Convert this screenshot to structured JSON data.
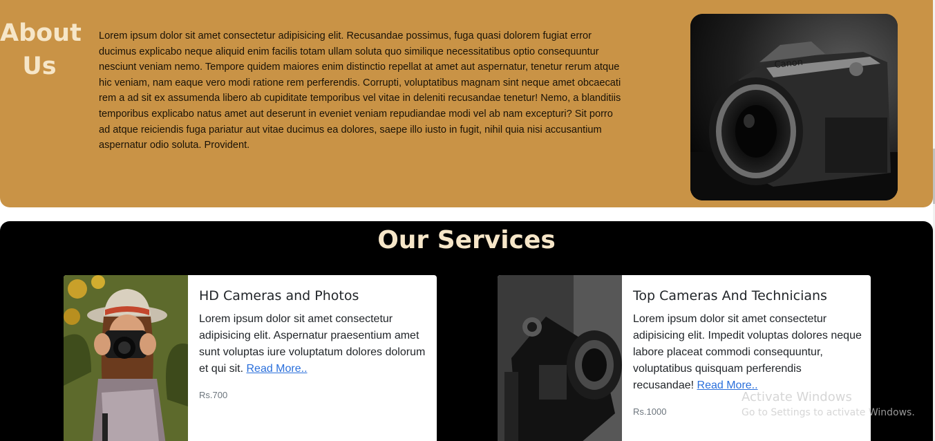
{
  "about": {
    "title_line1": "About",
    "title_line2": "Us",
    "paragraph": "Lorem ipsum dolor sit amet consectetur adipisicing elit. Recusandae possimus, fuga quasi dolorem fugiat error ducimus explicabo neque aliquid enim facilis totam ullam soluta quo similique necessitatibus optio consequuntur nesciunt veniam nemo. Tempore quidem maiores enim distinctio repellat at amet aut aspernatur, tenetur rerum atque hic veniam, nam eaque vero modi ratione rem perferendis. Corrupti, voluptatibus magnam sint neque amet obcaecati rem a ad sit ex assumenda libero ab cupiditate temporibus vel vitae in deleniti recusandae tenetur! Nemo, a blanditiis temporibus explicabo natus amet aut deserunt in eveniet veniam repudiandae modi vel ab nam excepturi? Sit porro ad atque reiciendis fuga pariatur aut vitae ducimus ea dolores, saepe illo iusto in fugit, nihil quia nisi accusantium aspernatur odio soluta. Provident.",
    "image_brand": "Canon"
  },
  "services": {
    "title": "Our Services",
    "cards": [
      {
        "title": "HD Cameras and Photos",
        "text": "Lorem ipsum dolor sit amet consectetur adipisicing elit. Aspernatur praesentium amet sunt voluptas iure voluptatum dolores dolorum et qui sit.",
        "link": "Read More..",
        "price": "Rs.700"
      },
      {
        "title": "Top Cameras And Technicians",
        "text": "Lorem ipsum dolor sit amet consectetur adipisicing elit. Impedit voluptas dolores neque labore placeat commodi consequuntur, voluptatibus quisquam perferendis recusandae!",
        "link": "Read More..",
        "price": "Rs.1000"
      }
    ]
  },
  "watermark": {
    "title": "Activate Windows",
    "subtitle": "Go to Settings to activate Windows."
  },
  "colors": {
    "about_bg": "#c99346",
    "heading": "#f6e6c8",
    "services_bg": "#000000",
    "link": "#2a6fdb"
  }
}
